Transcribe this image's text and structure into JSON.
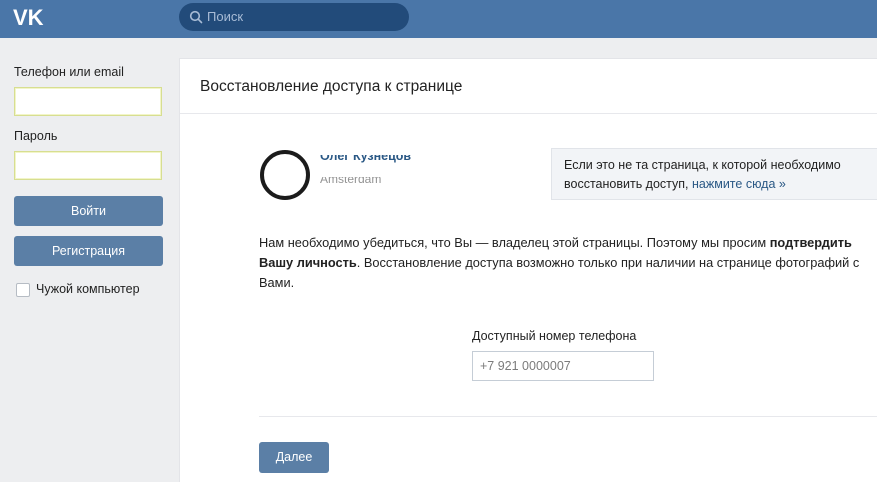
{
  "header": {
    "logo": "VK",
    "search_placeholder": "Поиск"
  },
  "login": {
    "phone_label": "Телефон или email",
    "password_label": "Пароль",
    "login_button": "Войти",
    "register_button": "Регистрация",
    "foreign_computer_label": "Чужой компьютер"
  },
  "recovery": {
    "title": "Восстановление доступа к странице",
    "user_name": "Олег Кузнецов",
    "user_city": "Amsterdam",
    "notice_text": "Если это не та страница, к которой необходимо восстановить доступ, ",
    "notice_link": "нажмите сюда »",
    "message_start": "Нам необходимо убедиться, что Вы — владелец этой страницы. Поэтому мы просим ",
    "message_bold": "подтвердить Вашу личность",
    "message_end": ". Восстановление доступа возможно только при наличии на странице фотографий с Вами.",
    "phone_label": "Доступный номер телефона",
    "phone_placeholder": "+7 921 0000007",
    "next_button": "Далее"
  },
  "colors": {
    "topbar": "#4a76a8",
    "button": "#5b7fa6",
    "link": "#2a5885"
  }
}
